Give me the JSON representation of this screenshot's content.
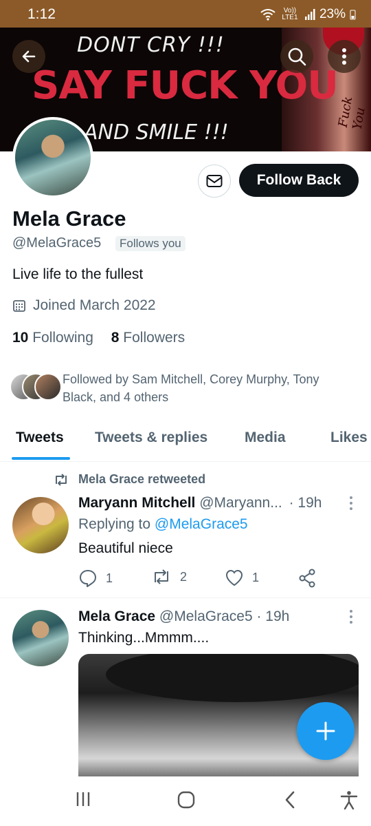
{
  "status_bar": {
    "time": "1:12",
    "network": "Vo)) LTE1",
    "battery": "23%"
  },
  "banner": {
    "line1": "DONT CRY !!!",
    "line2": "SAY FUCK YOU",
    "line3": "AND SMILE !!!",
    "finger_text": "Fuck You"
  },
  "profile": {
    "follow_button": "Follow Back",
    "name": "Mela Grace",
    "handle": "@MelaGrace5",
    "follows_you": "Follows you",
    "bio": "Live life to the fullest",
    "joined": "Joined March 2022",
    "following_count": "10",
    "following_label": "Following",
    "followers_count": "8",
    "followers_label": "Followers",
    "followed_by": "Followed by Sam Mitchell, Corey Murphy, Tony Black, and 4 others"
  },
  "tabs": [
    "Tweets",
    "Tweets & replies",
    "Media",
    "Likes"
  ],
  "tweets": [
    {
      "retweeted_by": "Mela Grace retweeted",
      "author": "Maryann Mitchell",
      "handle": "@Maryann...",
      "time": "· 19h",
      "replying_prefix": "Replying to",
      "replying_to": "@MelaGrace5",
      "text": "Beautiful niece",
      "replies": "1",
      "retweets": "2",
      "likes": "1"
    },
    {
      "author": "Mela Grace",
      "handle": "@MelaGrace5",
      "time": "· 19h",
      "text": "Thinking...Mmmm...."
    }
  ],
  "colors": {
    "accent": "#1d9bf0",
    "status_bar": "#8c5a28",
    "text": "#0f1419",
    "secondary": "#536471"
  },
  "icons": [
    "back-arrow-icon",
    "search-icon",
    "more-vertical-icon",
    "mail-icon",
    "calendar-icon",
    "retweet-icon",
    "reply-icon",
    "like-icon",
    "share-icon",
    "compose-plus-icon",
    "recent-apps-icon",
    "home-icon",
    "back-icon",
    "accessibility-icon"
  ]
}
